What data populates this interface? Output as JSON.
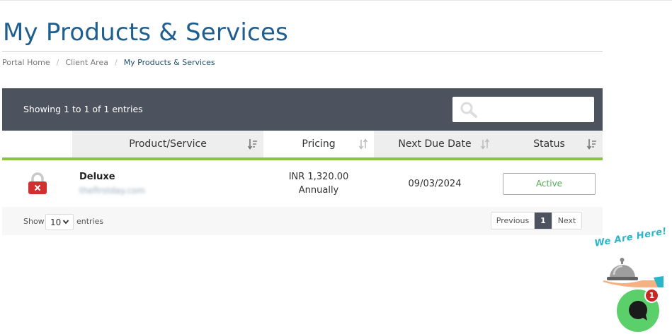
{
  "page": {
    "title": "My Products & Services"
  },
  "breadcrumb": [
    {
      "label": "Portal Home"
    },
    {
      "label": "Client Area"
    },
    {
      "label": "My Products & Services"
    }
  ],
  "toolbar": {
    "info": "Showing 1 to 1 of 1 entries",
    "search_placeholder": "",
    "search_icon": "search-icon"
  },
  "table": {
    "columns": [
      {
        "label": ""
      },
      {
        "label": "Product/Service",
        "sort_icon": "sort-desc-icon"
      },
      {
        "label": "Pricing",
        "sort_icon": "sort-both-icon"
      },
      {
        "label": "Next Due Date",
        "sort_icon": "sort-both-icon"
      },
      {
        "label": "Status",
        "sort_icon": "sort-desc-icon"
      }
    ],
    "rows": [
      {
        "icon": "lock-suspended-icon",
        "product": "Deluxe",
        "domain": "thefirstday.com",
        "price": "INR 1,320.00",
        "cycle": "Annually",
        "due": "09/03/2024",
        "status": "Active"
      }
    ]
  },
  "footer": {
    "show_label": "Show",
    "length_value": "10",
    "entries_label": "entries",
    "prev_label": "Previous",
    "page_number": "1",
    "next_label": "Next"
  },
  "chat": {
    "tagline": "We Are Here!",
    "badge_count": "1"
  },
  "colors": {
    "title": "#1f5f8f",
    "toolbar_bg": "#4d525f",
    "accent_green": "#8bc34a",
    "status_active": "#4caf50",
    "chat_button": "#5bd06a",
    "badge": "#c62828",
    "lock_red": "#d32f2f"
  }
}
